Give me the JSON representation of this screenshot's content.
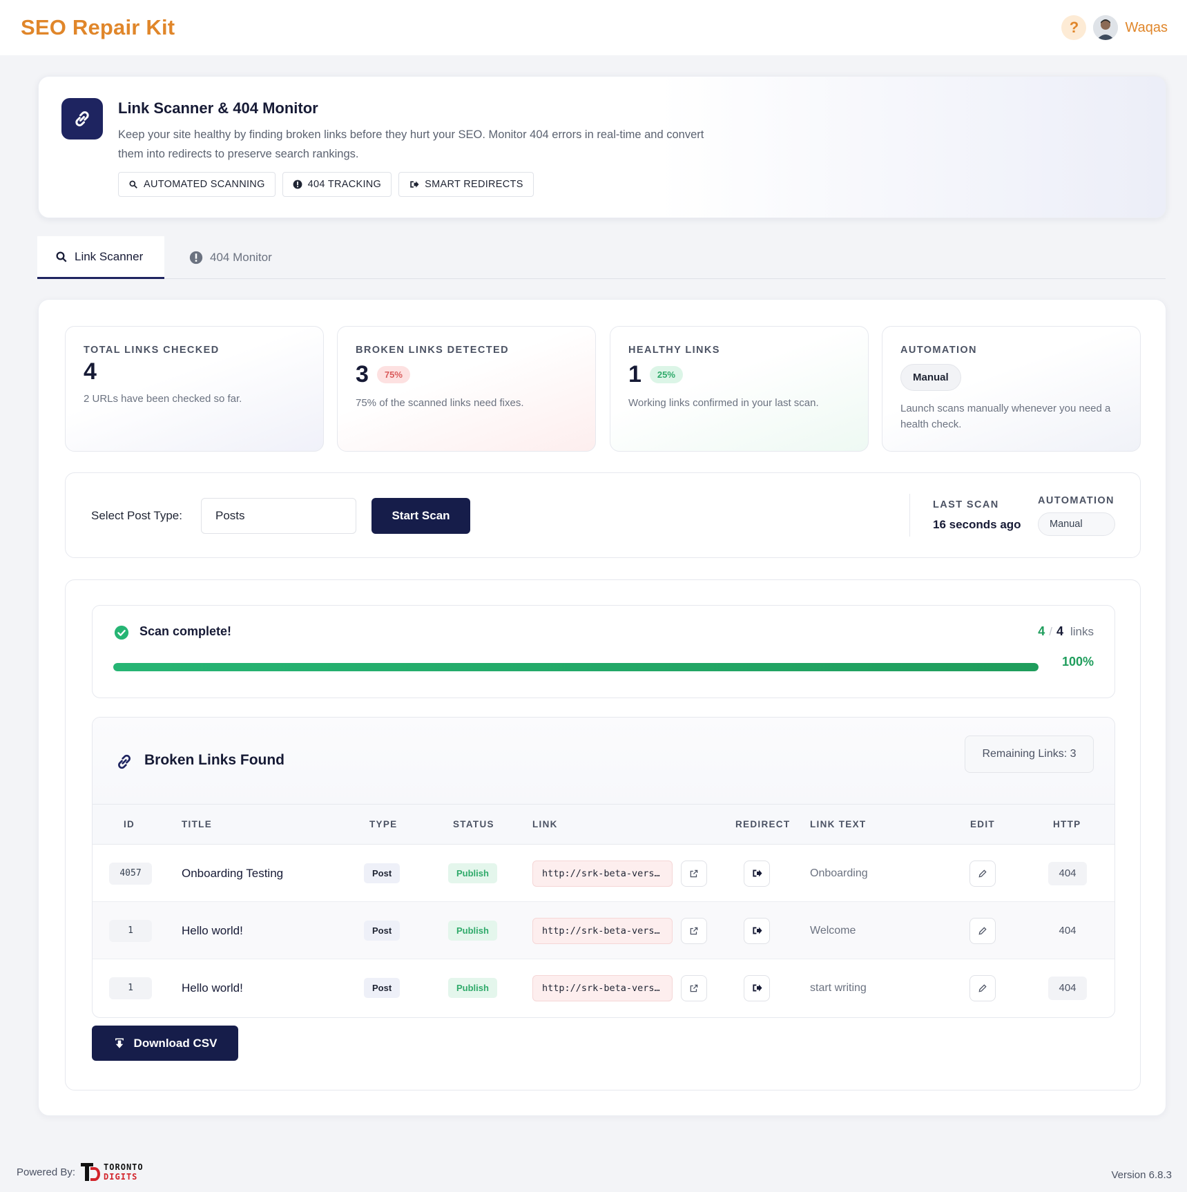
{
  "app": {
    "brand": "SEO Repair Kit",
    "help_label": "?",
    "user_name": "Waqas"
  },
  "hero": {
    "title": "Link Scanner & 404 Monitor",
    "description": "Keep your site healthy by finding broken links before they hurt your SEO. Monitor 404 errors in real-time and convert them into redirects to preserve search rankings.",
    "chips": [
      {
        "label": "AUTOMATED SCANNING",
        "icon": "search-icon"
      },
      {
        "label": "404 TRACKING",
        "icon": "alert-icon"
      },
      {
        "label": "SMART REDIRECTS",
        "icon": "redirect-icon"
      }
    ]
  },
  "tabs": [
    {
      "label": "Link Scanner",
      "icon": "search-icon",
      "active": true
    },
    {
      "label": "404 Monitor",
      "icon": "alert-icon",
      "active": false
    }
  ],
  "stats": {
    "total": {
      "label": "TOTAL LINKS CHECKED",
      "value": "4",
      "desc": "2 URLs have been checked so far."
    },
    "broken": {
      "label": "BROKEN LINKS DETECTED",
      "value": "3",
      "badge": "75%",
      "desc": "75% of the scanned links need fixes."
    },
    "healthy": {
      "label": "HEALTHY LINKS",
      "value": "1",
      "badge": "25%",
      "desc": "Working links confirmed in your last scan."
    },
    "automation": {
      "label": "AUTOMATION",
      "pill": "Manual",
      "desc": "Launch scans manually whenever you need a health check."
    }
  },
  "scan_controls": {
    "select_label": "Select Post Type:",
    "select_value": "Posts",
    "start_button": "Start Scan",
    "last_scan_label": "LAST SCAN",
    "last_scan_value": "16 seconds ago",
    "automation_label": "AUTOMATION",
    "automation_value": "Manual"
  },
  "progress": {
    "status": "Scan complete!",
    "done": "4",
    "separator": "/",
    "total": "4",
    "unit": "links",
    "percent_label": "100%",
    "fraction": 1.0
  },
  "broken_table": {
    "title": "Broken Links Found",
    "remaining": "Remaining Links: 3",
    "columns": [
      "ID",
      "TITLE",
      "TYPE",
      "STATUS",
      "LINK",
      "REDIRECT",
      "LINK TEXT",
      "EDIT",
      "HTTP"
    ],
    "rows": [
      {
        "id": "4057",
        "title": "Onboarding Testing",
        "type": "Post",
        "status": "Publish",
        "link": "http://srk-beta-vers…",
        "link_text": "Onboarding",
        "http": "404"
      },
      {
        "id": "1",
        "title": "Hello world!",
        "type": "Post",
        "status": "Publish",
        "link": "http://srk-beta-vers…",
        "link_text": "Welcome",
        "http": "404"
      },
      {
        "id": "1",
        "title": "Hello world!",
        "type": "Post",
        "status": "Publish",
        "link": "http://srk-beta-vers…",
        "link_text": "start writing",
        "http": "404"
      }
    ]
  },
  "download_button": "Download CSV",
  "footer": {
    "powered_by": "Powered By:",
    "logo_line1": "TORONTO",
    "logo_line2": "DIGITS",
    "version": "Version 6.8.3"
  },
  "colors": {
    "brand": "#e0862a",
    "navy": "#161d4a",
    "success": "#1f9d5c",
    "danger": "#d95b5b"
  }
}
